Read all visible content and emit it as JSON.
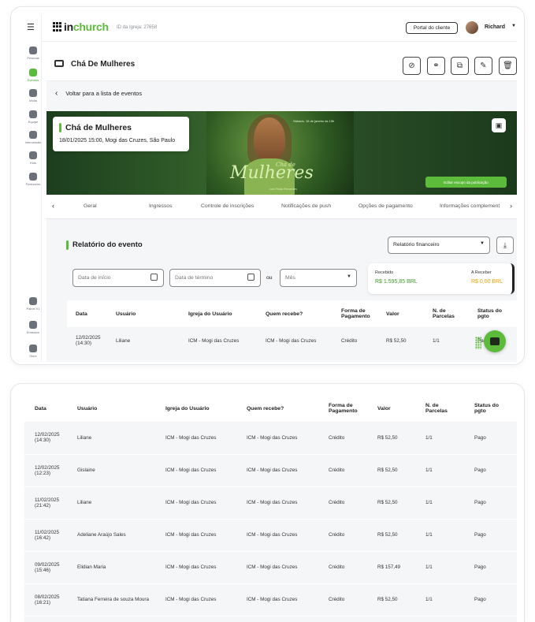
{
  "header": {
    "logo_main": "in",
    "logo_accent": "church",
    "church_id": "ID da Igreja: 27658",
    "portal_button": "Portal do cliente",
    "user_name": "Richard"
  },
  "sidebar": {
    "items": [
      {
        "label": "Pessoas",
        "icon": "people-icon"
      },
      {
        "label": "Eventos",
        "icon": "ticket-icon"
      },
      {
        "label": "Mídia",
        "icon": "video-icon"
      },
      {
        "label": "Equipe",
        "icon": "team-icon"
      },
      {
        "label": "Intercessão",
        "icon": "prayer-icon"
      },
      {
        "label": "Kids",
        "icon": "kids-icon"
      },
      {
        "label": "Financeiro",
        "icon": "finance-icon"
      },
      {
        "label": "Painel V1",
        "icon": "grid-icon"
      },
      {
        "label": "Emission",
        "icon": "rocket-icon"
      },
      {
        "label": "Store",
        "icon": "bag-icon"
      }
    ]
  },
  "event": {
    "name": "Chá De Mulheres",
    "back_label": "Voltar para a lista de eventos",
    "card_title": "Chá de Mulheres",
    "card_details": "18/01/2025 15:00, Mogi das Cruzes, São Paulo",
    "banner_date": "Sábado, 18 de janeiro às 15h",
    "banner_script": "Mulheres",
    "banner_script_small": "Chá de",
    "banner_sub": "com Pricila Fernandes",
    "edit_cover_label": "Editar escopo da publicação"
  },
  "tabs": [
    "Geral",
    "Ingressos",
    "Controle de inscrições",
    "Notificações de push",
    "Opções de pagamento",
    "Informações complement"
  ],
  "report": {
    "title": "Relatório do evento",
    "select_value": "Relatório financeiro",
    "start_placeholder": "Data de início",
    "end_placeholder": "Data de término",
    "or_label": "ou",
    "month_placeholder": "Mês",
    "received_label": "Recebido",
    "received_value": "R$ 1.595,85 BRL",
    "pending_label": "A Receber",
    "pending_value": "R$ 0,00 BRL",
    "colors": {
      "received": "#3e9b2a",
      "pending": "#e9a100",
      "accent": "#5dbb3c"
    }
  },
  "table": {
    "headers": {
      "data": "Data",
      "usuario": "Usuário",
      "igreja": "Igreja do Usuário",
      "quem": "Quem recebe?",
      "forma1": "Forma de",
      "forma2": "Pagamento",
      "valor": "Valor",
      "parc1": "N. de",
      "parc2": "Parcelas",
      "status1": "Status do",
      "status2": "pgto"
    },
    "rows": [
      {
        "date": "12/02/2025",
        "time": "(14:30)",
        "user": "Liliane",
        "church": "ICM - Mogi das Cruzes",
        "receiver": "ICM - Mogi das Cruzes",
        "method": "Crédito",
        "value": "R$ 52,50",
        "installments": "1/1",
        "status": "Pago"
      },
      {
        "date": "12/02/2025",
        "time": "(12:23)",
        "user": "Gislaine",
        "church": "ICM - Mogi das Cruzes",
        "receiver": "ICM - Mogi das Cruzes",
        "method": "Crédito",
        "value": "R$ 52,50",
        "installments": "1/1",
        "status": "Pago"
      },
      {
        "date": "11/02/2025",
        "time": "(21:42)",
        "user": "Liliane",
        "church": "ICM - Mogi das Cruzes",
        "receiver": "ICM - Mogi das Cruzes",
        "method": "Crédito",
        "value": "R$ 52,50",
        "installments": "1/1",
        "status": "Pago"
      },
      {
        "date": "11/02/2025",
        "time": "(16:42)",
        "user": "Adeliane Araújo Sales",
        "church": "ICM - Mogi das Cruzes",
        "receiver": "ICM - Mogi das Cruzes",
        "method": "Crédito",
        "value": "R$ 52,50",
        "installments": "1/1",
        "status": "Pago"
      },
      {
        "date": "09/02/2025",
        "time": "(15:46)",
        "user": "Elidian Maria",
        "church": "ICM - Mogi das Cruzes",
        "receiver": "ICM - Mogi das Cruzes",
        "method": "Crédito",
        "value": "R$ 157,49",
        "installments": "1/1",
        "status": "Pago"
      },
      {
        "date": "08/02/2025",
        "time": "(16:21)",
        "user": "Tatiana Ferreira de souza Moura",
        "church": "ICM - Mogi das Cruzes",
        "receiver": "ICM - Mogi das Cruzes",
        "method": "Crédito",
        "value": "R$ 52,50",
        "installments": "1/1",
        "status": "Pago"
      }
    ]
  }
}
